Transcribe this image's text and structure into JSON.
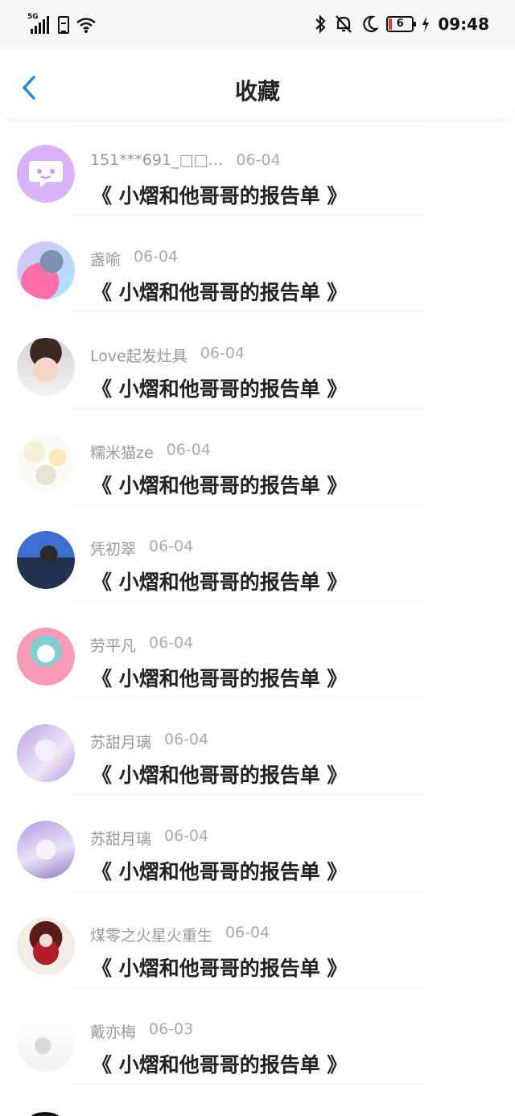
{
  "status_bar": {
    "network": "5G",
    "battery_level": "6",
    "time": "09:48",
    "icons": [
      "signal-icon",
      "sim-icon",
      "wifi-icon",
      "bluetooth-icon",
      "mute-icon",
      "moon-icon",
      "battery-icon",
      "charging-icon"
    ]
  },
  "header": {
    "back_icon": "chevron-left-icon",
    "title": "收藏"
  },
  "items": [
    {
      "name": "151***691_□□…",
      "date": "06-04",
      "post": "《 小熠和他哥哥的报告单 》",
      "avatar": "chat-bubble"
    },
    {
      "name": "盏喻",
      "date": "06-04",
      "post": "《 小熠和他哥哥的报告单 》",
      "avatar": "photo"
    },
    {
      "name": "Love起发灶具",
      "date": "06-04",
      "post": "《 小熠和他哥哥的报告单 》",
      "avatar": "photo"
    },
    {
      "name": "糯米猫ze",
      "date": "06-04",
      "post": "《 小熠和他哥哥的报告单 》",
      "avatar": "photo"
    },
    {
      "name": "凭初翠",
      "date": "06-04",
      "post": "《 小熠和他哥哥的报告单 》",
      "avatar": "photo"
    },
    {
      "name": "劳平凡",
      "date": "06-04",
      "post": "《 小熠和他哥哥的报告单 》",
      "avatar": "photo"
    },
    {
      "name": "苏甜月璃",
      "date": "06-04",
      "post": "《 小熠和他哥哥的报告单 》",
      "avatar": "photo"
    },
    {
      "name": "苏甜月璃",
      "date": "06-04",
      "post": "《 小熠和他哥哥的报告单 》",
      "avatar": "photo"
    },
    {
      "name": "煤零之火星火重生",
      "date": "06-04",
      "post": "《 小熠和他哥哥的报告单 》",
      "avatar": "photo"
    },
    {
      "name": "戴亦梅",
      "date": "06-03",
      "post": "《 小熠和他哥哥的报告单 》",
      "avatar": "photo"
    }
  ]
}
